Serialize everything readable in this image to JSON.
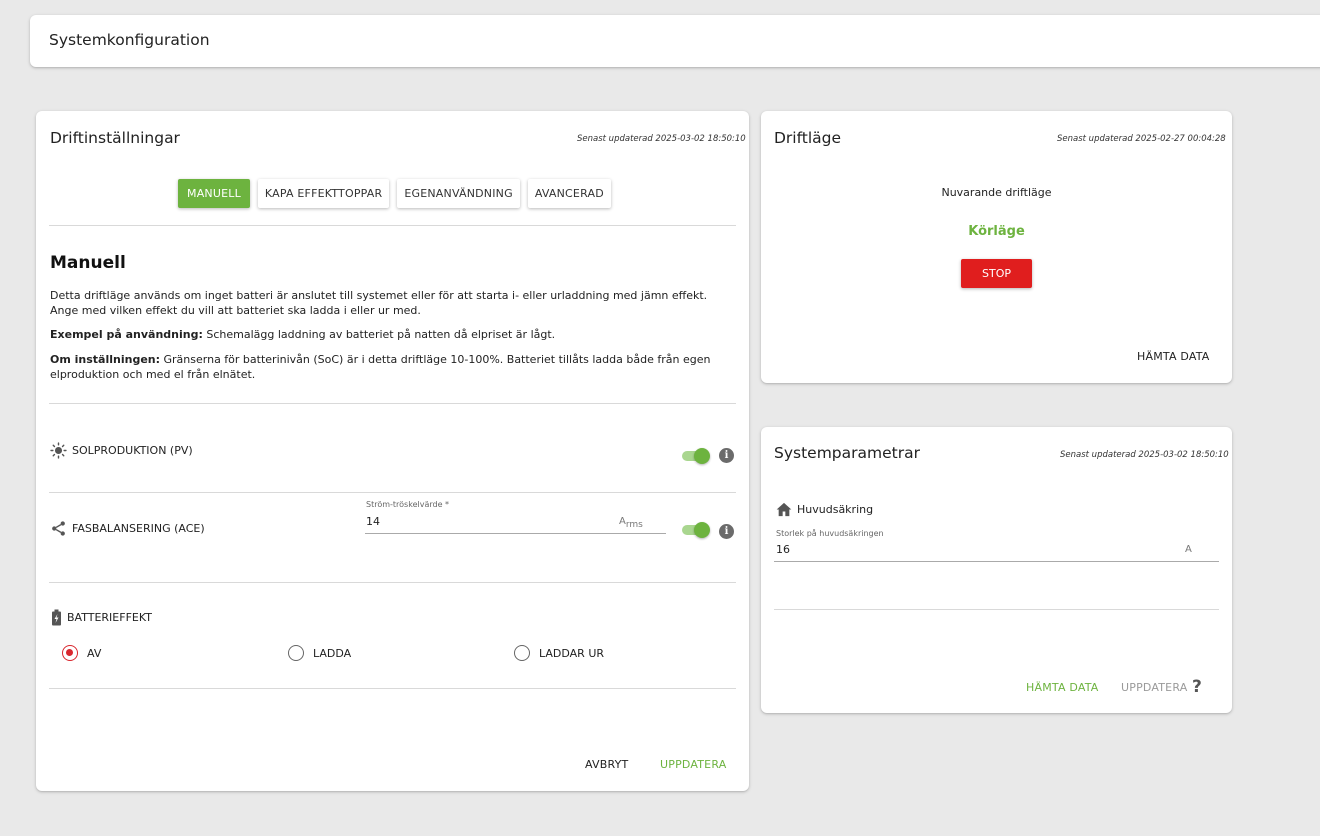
{
  "header": {
    "title": "Systemkonfiguration"
  },
  "drift": {
    "title": "Driftinställningar",
    "updated": "Senast updaterad 2025-03-02 18:50:10",
    "tabs": [
      {
        "label": "MANUELL",
        "active": true
      },
      {
        "label": "KAPA EFFEKTTOPPAR",
        "active": false
      },
      {
        "label": "EGENANVÄNDNING",
        "active": false
      },
      {
        "label": "AVANCERAD",
        "active": false
      }
    ],
    "heading": "Manuell",
    "description": "Detta driftläge används om inget batteri är anslutet till systemet eller för att starta i- eller urladdning med jämn effekt. Ange med vilken effekt du vill att batteriet ska ladda i eller ur med.",
    "example_label": "Exempel på användning:",
    "example_text": " Schemalägg laddning av batteriet på natten då elpriset är lågt.",
    "settings_label": "Om inställningen:",
    "settings_text": " Gränserna för batterinivån (SoC) är i detta driftläge 10-100%. Batteriet tillåts ladda både från egen elproduktion och med el från elnätet.",
    "pv": {
      "label": "SOLPRODUKTION (PV)",
      "icon": "sun-icon",
      "enabled": true
    },
    "ace": {
      "label": "FASBALANSERING (ACE)",
      "icon": "share-icon",
      "enabled": true,
      "field_label": "Ström-tröskelvärde *",
      "field_value": "14",
      "unit_main": "A",
      "unit_sub": "rms"
    },
    "battery": {
      "label": "BATTERIEFFEKT",
      "icon": "battery-icon",
      "options": [
        {
          "label": "AV",
          "checked": true
        },
        {
          "label": "LADDA",
          "checked": false
        },
        {
          "label": "LADDAR UR",
          "checked": false
        }
      ]
    },
    "cancel_label": "AVBRYT",
    "update_label": "UPPDATERA"
  },
  "driftlage": {
    "title": "Driftläge",
    "updated": "Senast updaterad 2025-02-27 00:04:28",
    "current_label": "Nuvarande driftläge",
    "current_value": "Körläge",
    "stop_label": "STOP",
    "fetch_label": "HÄMTA DATA"
  },
  "sysparam": {
    "title": "Systemparametrar",
    "updated": "Senast updaterad 2025-03-02 18:50:10",
    "fuse_label": "Huvudsäkring",
    "fuse_icon": "home-icon",
    "field_label": "Storlek på huvudsäkringen",
    "field_value": "16",
    "unit": "A",
    "fetch_label": "HÄMTA DATA",
    "update_label": "UPPDATERA",
    "help_label": "?"
  },
  "colors": {
    "accent": "#6db33f",
    "stop": "#e01e1e",
    "radio_checked": "#d9272e"
  }
}
